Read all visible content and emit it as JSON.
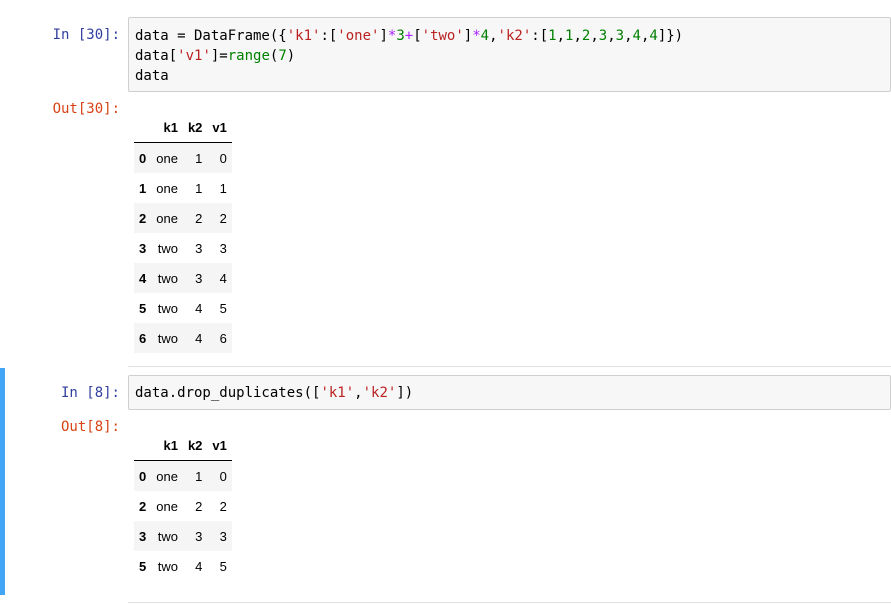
{
  "cells": [
    {
      "in_prompt": "In  [30]:",
      "code_lines": [
        [
          [
            "data = DataFrame({",
            ""
          ],
          [
            "'k1'",
            "str"
          ],
          [
            ":[",
            ""
          ],
          [
            "'one'",
            "str"
          ],
          [
            "]",
            ""
          ],
          [
            "*",
            "op"
          ],
          [
            "3",
            "num"
          ],
          [
            "+",
            "op"
          ],
          [
            "[",
            ""
          ],
          [
            "'two'",
            "str"
          ],
          [
            "]",
            ""
          ],
          [
            "*",
            "op"
          ],
          [
            "4",
            "num"
          ],
          [
            ",",
            ""
          ],
          [
            "'k2'",
            "str"
          ],
          [
            ":[",
            ""
          ],
          [
            "1",
            "num"
          ],
          [
            ",",
            ""
          ],
          [
            "1",
            "num"
          ],
          [
            ",",
            ""
          ],
          [
            "2",
            "num"
          ],
          [
            ",",
            ""
          ],
          [
            "3",
            "num"
          ],
          [
            ",",
            ""
          ],
          [
            "3",
            "num"
          ],
          [
            ",",
            ""
          ],
          [
            "4",
            "num"
          ],
          [
            ",",
            ""
          ],
          [
            "4",
            "num"
          ],
          [
            "]})",
            ""
          ]
        ],
        [
          [
            "data[",
            ""
          ],
          [
            "'v1'",
            "str"
          ],
          [
            "]=",
            ""
          ],
          [
            "range",
            "bi"
          ],
          [
            "(",
            ""
          ],
          [
            "7",
            "num"
          ],
          [
            ")",
            ""
          ]
        ],
        [
          [
            "data",
            ""
          ]
        ]
      ],
      "out_prompt": "Out[30]:",
      "table": {
        "columns": [
          "k1",
          "k2",
          "v1"
        ],
        "rows": [
          {
            "index": "0",
            "values": [
              "one",
              "1",
              "0"
            ]
          },
          {
            "index": "1",
            "values": [
              "one",
              "1",
              "1"
            ]
          },
          {
            "index": "2",
            "values": [
              "one",
              "2",
              "2"
            ]
          },
          {
            "index": "3",
            "values": [
              "two",
              "3",
              "3"
            ]
          },
          {
            "index": "4",
            "values": [
              "two",
              "3",
              "4"
            ]
          },
          {
            "index": "5",
            "values": [
              "two",
              "4",
              "5"
            ]
          },
          {
            "index": "6",
            "values": [
              "two",
              "4",
              "6"
            ]
          }
        ]
      }
    },
    {
      "in_prompt": "In  [8]:",
      "code_lines": [
        [
          [
            "data.drop_duplicates([",
            ""
          ],
          [
            "'k1'",
            "str"
          ],
          [
            ",",
            ""
          ],
          [
            "'k2'",
            "str"
          ],
          [
            "])",
            ""
          ]
        ]
      ],
      "out_prompt": "Out[8]:",
      "table": {
        "columns": [
          "k1",
          "k2",
          "v1"
        ],
        "rows": [
          {
            "index": "0",
            "values": [
              "one",
              "1",
              "0"
            ]
          },
          {
            "index": "2",
            "values": [
              "one",
              "2",
              "2"
            ]
          },
          {
            "index": "3",
            "values": [
              "two",
              "3",
              "3"
            ]
          },
          {
            "index": "5",
            "values": [
              "two",
              "4",
              "5"
            ]
          }
        ]
      }
    }
  ],
  "colors": {
    "selected_bar": "#42a5f5",
    "in_prompt": "#303f9f",
    "out_prompt": "#d84315",
    "string": "#ba2121",
    "operator": "#aa22ff",
    "number": "#008000"
  }
}
